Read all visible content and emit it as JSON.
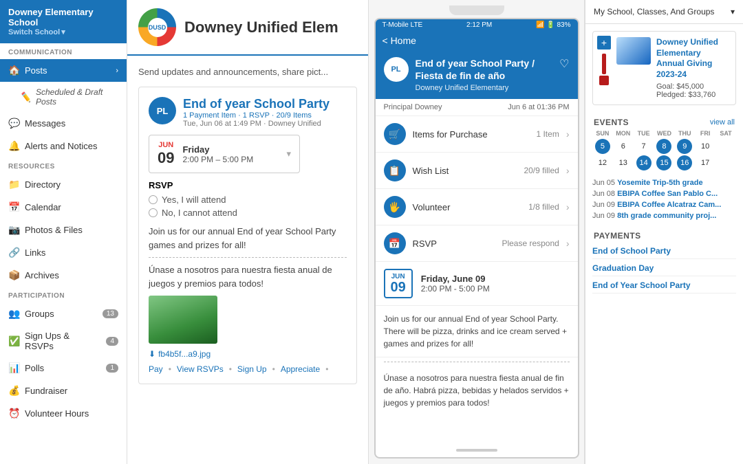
{
  "school": {
    "name": "Downey Elementary School",
    "switch_label": "Switch School",
    "district": "Downey Unified Elem"
  },
  "sidebar": {
    "communication_label": "COMMUNICATION",
    "resources_label": "RESOURCES",
    "participation_label": "PARTICIPATION",
    "items": [
      {
        "id": "posts",
        "label": "Posts",
        "icon": "🏠",
        "active": true
      },
      {
        "id": "scheduled",
        "label": "Scheduled & Draft Posts",
        "icon": "✏️",
        "sub": true
      },
      {
        "id": "messages",
        "label": "Messages",
        "icon": "💬"
      },
      {
        "id": "alerts",
        "label": "Alerts and Notices",
        "icon": "🔔"
      },
      {
        "id": "directory",
        "label": "Directory",
        "icon": "📁"
      },
      {
        "id": "calendar",
        "label": "Calendar",
        "icon": "📅"
      },
      {
        "id": "photos",
        "label": "Photos & Files",
        "icon": "📷"
      },
      {
        "id": "links",
        "label": "Links",
        "icon": "🔗"
      },
      {
        "id": "archives",
        "label": "Archives",
        "icon": "📦"
      },
      {
        "id": "groups",
        "label": "Groups",
        "icon": "👥",
        "badge": "13"
      },
      {
        "id": "signups",
        "label": "Sign Ups & RSVPs",
        "icon": "✅",
        "badge": "4"
      },
      {
        "id": "polls",
        "label": "Polls",
        "icon": "📊",
        "badge": "1"
      },
      {
        "id": "fundraiser",
        "label": "Fundraiser",
        "icon": "💰"
      },
      {
        "id": "volunteer",
        "label": "Volunteer Hours",
        "icon": "⏰"
      }
    ]
  },
  "main": {
    "header_title": "Downey Unified Elem",
    "logo_text": "DUSD",
    "send_updates_text": "Send updates and announcements, share pict...",
    "post": {
      "avatar_initials": "PL",
      "title": "End of year School Party",
      "meta": "1 Payment Item · 1 RSVP · 20/9 Items",
      "date_posted": "Tue, Jun 06 at 1:49 PM · Downey Unified",
      "event_month": "JUN",
      "event_day": "09",
      "event_dow": "Friday",
      "event_time": "2:00 PM – 5:00 PM",
      "rsvp_label": "RSVP",
      "rsvp_yes": "Yes, I will attend",
      "rsvp_no": "No, I cannot attend",
      "body_en": "Join us for our annual End of year School Party games and prizes for all!",
      "divider": "----------------",
      "body_es": "Únase a nosotros para nuestra fiesta anual de juegos y premios para todos!",
      "file_name": "fb4b5f...a9.jpg",
      "actions": [
        "Pay",
        "View RSVPs",
        "Sign Up",
        "Appreciate",
        ""
      ]
    }
  },
  "phone": {
    "carrier": "T-Mobile  LTE",
    "time": "2:12 PM",
    "battery": "83%",
    "nav_back": "< Home",
    "post_title": "End of year School Party / Fiesta de fin de año",
    "school_name": "Downey Unified Elementary",
    "avatar_initials": "PL",
    "author": "Principal Downey",
    "date": "Jun 6 at 01:36 PM",
    "heart_icon": "♡",
    "rows": [
      {
        "icon": "🛒",
        "label": "Items for Purchase",
        "value": "1 Item"
      },
      {
        "icon": "📋",
        "label": "Wish List",
        "value": "20/9 filled"
      },
      {
        "icon": "🖐",
        "label": "Volunteer",
        "value": "1/8 filled"
      },
      {
        "icon": "📅",
        "label": "RSVP",
        "value": "Please respond"
      }
    ],
    "event_month": "JUN",
    "event_day": "09",
    "event_dow": "Friday, June 09",
    "event_time": "2:00 PM - 5:00 PM",
    "body_en": "Join us for our annual End of year School Party. There will be pizza, drinks and ice cream served + games and prizes for all!",
    "body_es": "Únase a nosotros para nuestra fiesta anual de fin de año. Habrá pizza, bebidas y helados servidos + juegos y premios para todos!"
  },
  "right": {
    "selector_label": "My School, Classes, And Groups",
    "giving_title": "Downey Unified Elementary Annual Giving 2023-24",
    "giving_goal": "Goal: $45,000",
    "giving_pledged": "Pledged: $33,760",
    "events_title": "EVENTS",
    "events_link": "view all",
    "calendar": {
      "days_of_week": [
        "SUN",
        "MON",
        "TUE",
        "WED",
        "THU",
        "FRI",
        "SAT"
      ],
      "week1": [
        null,
        null,
        null,
        null,
        null,
        null,
        null
      ],
      "week2": [
        "5",
        "6",
        "7",
        "8",
        "9",
        "10",
        null
      ],
      "week3": [
        "12",
        "13",
        "14",
        "15",
        "16",
        "17",
        null
      ],
      "highlights": [
        "5",
        "8",
        "9",
        "14",
        "15",
        "16"
      ]
    },
    "events": [
      {
        "date": "Jun 05",
        "name": "Yosemite Trip-5th grade"
      },
      {
        "date": "Jun 08",
        "name": "EBIPA Coffee San Pablo C..."
      },
      {
        "date": "Jun 09",
        "name": "EBIPA Coffee Alcatraz Cam..."
      },
      {
        "date": "Jun 09",
        "name": "8th grade community proj..."
      }
    ],
    "payments_title": "PAYMENTS",
    "payments": [
      "End of School Party",
      "Graduation Day",
      "End of Year School Party"
    ]
  }
}
